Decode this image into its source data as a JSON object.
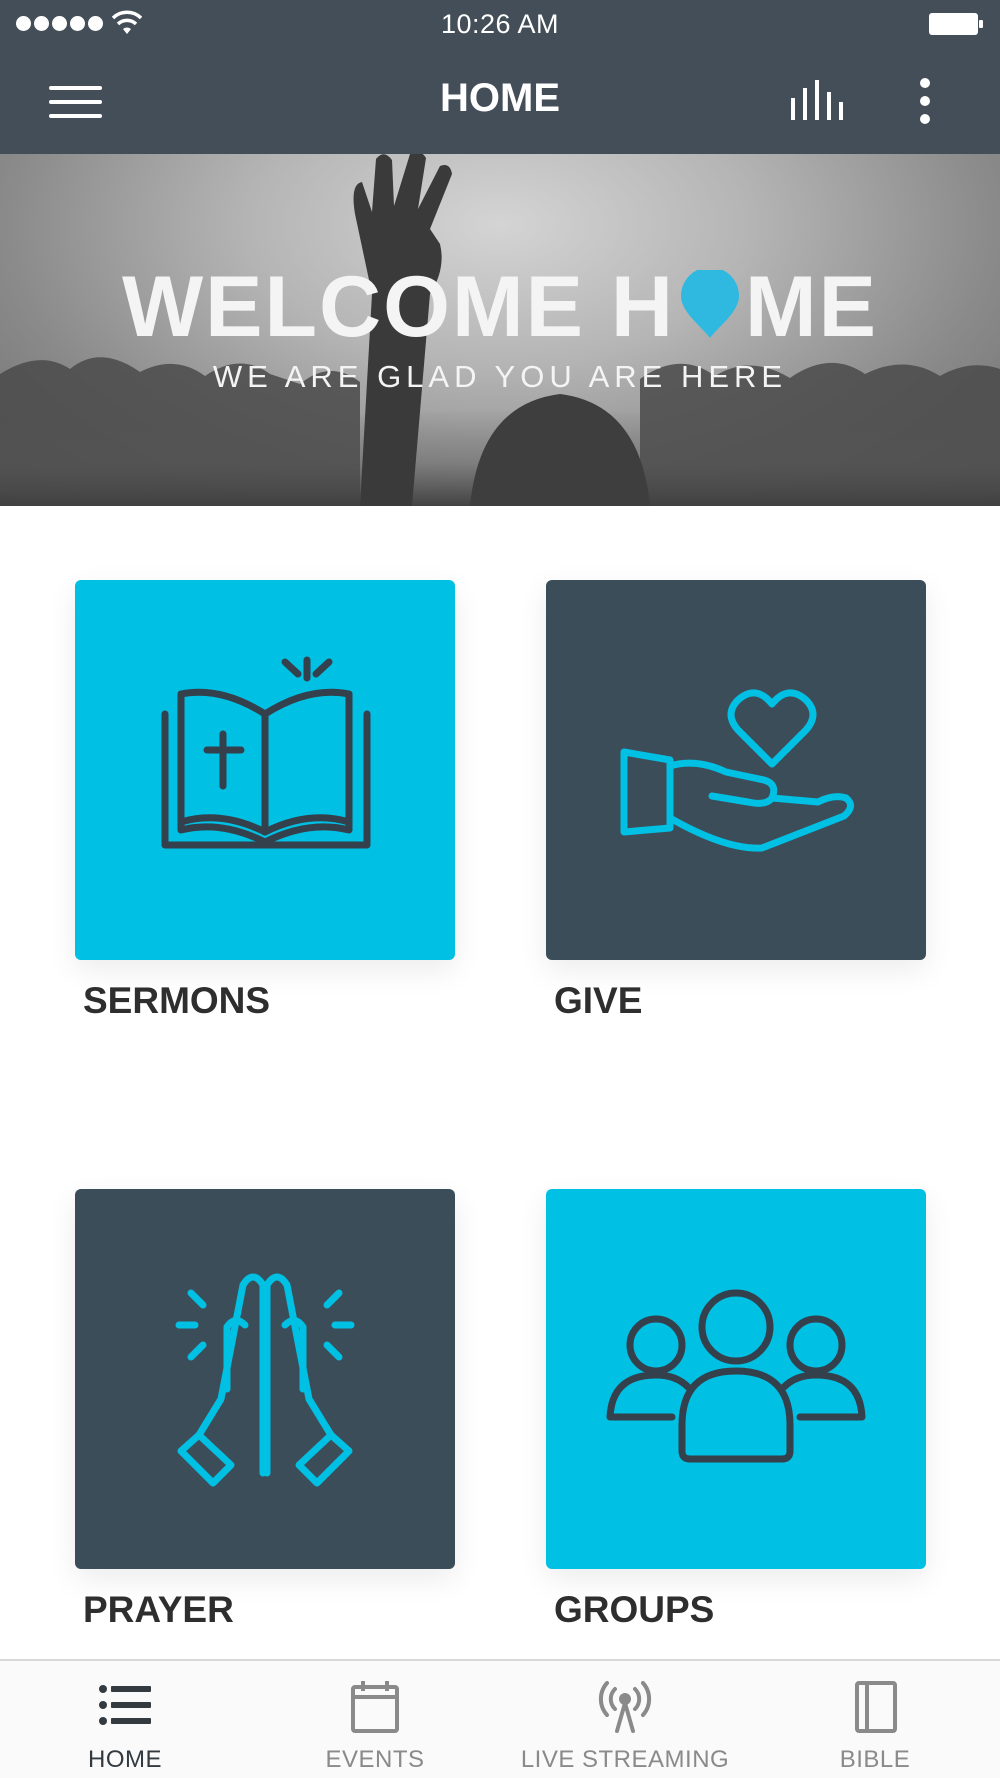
{
  "status_bar": {
    "time": "10:26 AM"
  },
  "nav": {
    "title": "HOME"
  },
  "banner": {
    "title_part1": "WELCOME H",
    "title_part2": "ME",
    "subtitle": "WE ARE GLAD YOU ARE HERE"
  },
  "tiles": [
    {
      "label": "SERMONS",
      "icon": "bible-icon",
      "color": "#00c0e4"
    },
    {
      "label": "GIVE",
      "icon": "giving-hand-icon",
      "color": "#3c4d5a"
    },
    {
      "label": "PRAYER",
      "icon": "praying-hands-icon",
      "color": "#3c4d5a"
    },
    {
      "label": "GROUPS",
      "icon": "group-icon",
      "color": "#00c0e4"
    }
  ],
  "tab_bar": {
    "items": [
      {
        "label": "HOME",
        "icon": "list-icon",
        "active": true
      },
      {
        "label": "EVENTS",
        "icon": "calendar-icon",
        "active": false
      },
      {
        "label": "LIVE STREAMING",
        "icon": "broadcast-icon",
        "active": false
      },
      {
        "label": "BIBLE",
        "icon": "book-icon",
        "active": false
      }
    ]
  },
  "colors": {
    "header": "#434e58",
    "accent": "#00c0e4",
    "dark_tile": "#3c4d5a",
    "icon_dark": "#34414c"
  }
}
